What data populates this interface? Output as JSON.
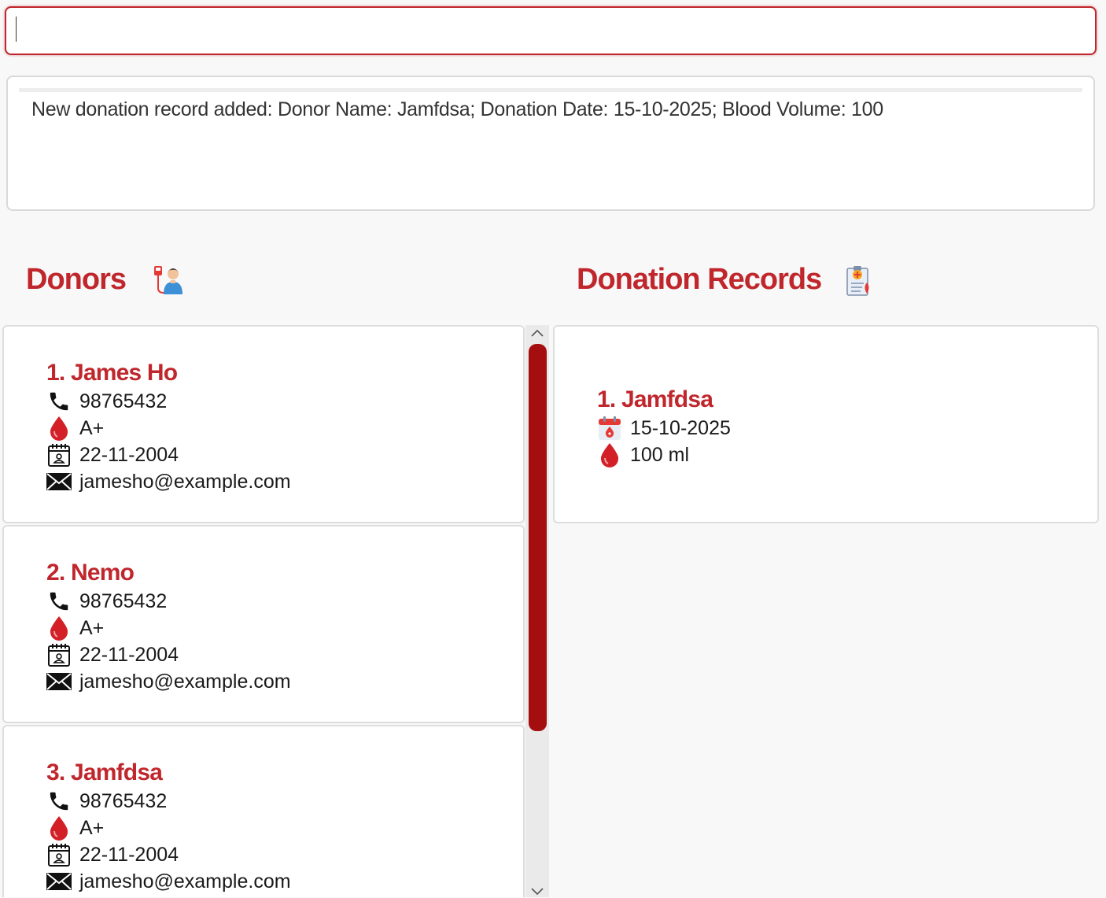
{
  "command_box": {
    "value": ""
  },
  "result_display": {
    "text": "New donation record added: Donor Name: Jamfdsa; Donation Date: 15-10-2025; Blood Volume: 100"
  },
  "donors_panel": {
    "title": "Donors",
    "icon": "blood-donor-icon",
    "items": [
      {
        "title": "1. James Ho",
        "phone": "98765432",
        "blood_type": "A+",
        "dob": "22-11-2004",
        "email": "jamesho@example.com"
      },
      {
        "title": "2. Nemo",
        "phone": "98765432",
        "blood_type": "A+",
        "dob": "22-11-2004",
        "email": "jamesho@example.com"
      },
      {
        "title": "3. Jamfdsa",
        "phone": "98765432",
        "blood_type": "A+",
        "dob": "22-11-2004",
        "email": "jamesho@example.com"
      }
    ]
  },
  "records_panel": {
    "title": "Donation Records",
    "icon": "medical-record-icon",
    "items": [
      {
        "title": "1. Jamfdsa",
        "date": "15-10-2025",
        "volume": "100 ml"
      }
    ]
  },
  "colors": {
    "accent": "#c0272d",
    "scroll_thumb": "#a50e0e"
  }
}
